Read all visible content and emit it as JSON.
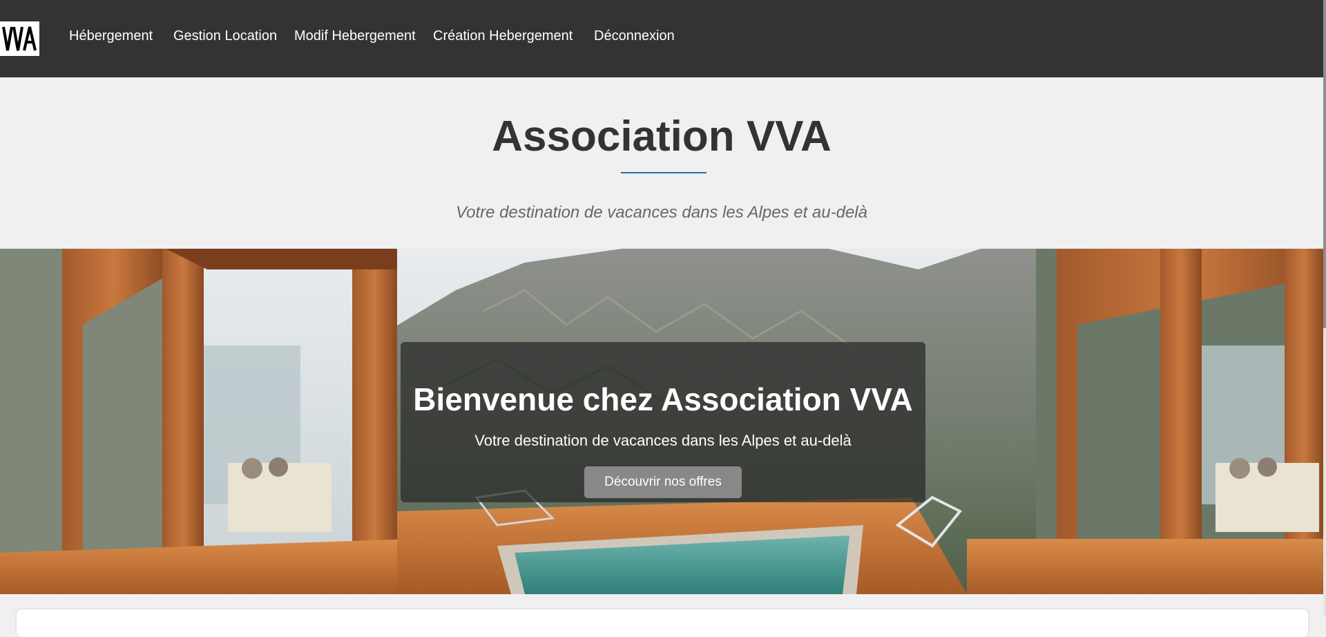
{
  "nav": {
    "logo_text": "VVA",
    "links": [
      {
        "label": "Hébergement"
      },
      {
        "label": "Gestion Location"
      },
      {
        "label": "Modif Hebergement"
      },
      {
        "label": "Création Hebergement"
      },
      {
        "label": "Déconnexion"
      }
    ]
  },
  "header": {
    "title": "Association VVA",
    "tagline": "Votre destination de vacances dans les Alpes et au-delà",
    "accent_color": "#1e6bb8"
  },
  "hero": {
    "title": "Bienvenue chez Association VVA",
    "subtitle": "Votre destination de vacances dans les Alpes et au-delà",
    "button_label": "Découvrir nos offres"
  }
}
